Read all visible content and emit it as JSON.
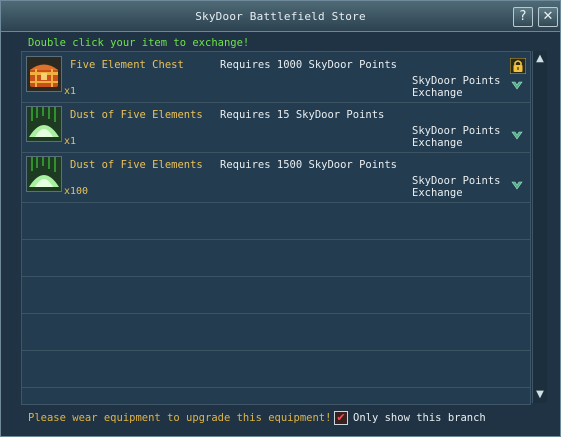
{
  "window": {
    "title": "SkyDoor Battlefield Store",
    "help_label": "?",
    "close_label": "✕"
  },
  "hint": "Double click your item to exchange!",
  "items": [
    {
      "name": "Five Element Chest",
      "quantity": "x1",
      "requirement": "Requires 1000 SkyDoor Points",
      "action": "SkyDoor Points Exchange",
      "icon": "chest-icon",
      "locked": true
    },
    {
      "name": "Dust of Five Elements",
      "quantity": "x1",
      "requirement": "Requires 15 SkyDoor Points",
      "action": "SkyDoor Points Exchange",
      "icon": "dust-icon",
      "locked": false
    },
    {
      "name": "Dust of Five Elements",
      "quantity": "x100",
      "requirement": "Requires 1500 SkyDoor Points",
      "action": "SkyDoor Points Exchange",
      "icon": "dust-icon",
      "locked": false
    }
  ],
  "footer": {
    "message": "Please wear equipment to upgrade this equipment!",
    "checkbox_label": "Only show this branch",
    "checkbox_checked": true
  },
  "colors": {
    "hint": "#6fe24a",
    "item_name": "#e8c15a",
    "footer_message": "#e0b445"
  }
}
